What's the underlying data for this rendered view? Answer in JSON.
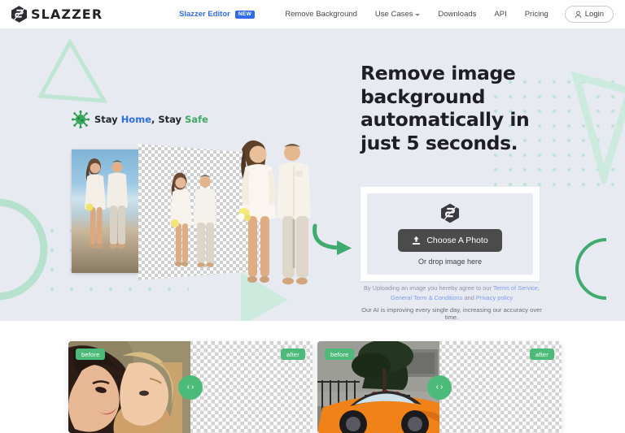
{
  "header": {
    "logo_text": "SLAZZER",
    "logo_icon": "slazzer-diamond-logo-icon",
    "nav": [
      {
        "label": "Slazzer Editor",
        "badge": "NEW",
        "accent": true
      },
      {
        "label": "Remove Background"
      },
      {
        "label": "Use Cases",
        "has_chevron": true
      },
      {
        "label": "Downloads"
      },
      {
        "label": "API"
      },
      {
        "label": "Pricing"
      }
    ],
    "login_label": "Login",
    "login_icon": "user-account-icon",
    "accent_color": "#2f6bf0"
  },
  "hero": {
    "headline": "Remove image background automatically in just 5 seconds.",
    "stay_safe": {
      "icon": "coronavirus-icon",
      "part1": "Stay ",
      "home": "Home",
      "part2": ", Stay ",
      "safe": "Safe"
    },
    "arrow_icon": "curved-arrow-right-icon",
    "upload": {
      "logo_icon": "slazzer-diamond-logo-icon",
      "button_label": "Choose A Photo",
      "button_icon": "upload-icon",
      "drop_text": "Or drop image here",
      "button_color": "#4b4b4b"
    },
    "legal": {
      "prefix": "By Uploading an image you hereby agree to our ",
      "link1": "Terms of Service",
      "sep1": ", ",
      "link2": "General Term & Conditions",
      "sep2": " and ",
      "link3": "Privacy policy"
    },
    "ai_note": "Our AI is improving every single day, increasing our accuracy over time.",
    "background_color": "#e8eaf2",
    "decor_green": "#b8e3cf"
  },
  "showcase": {
    "cards": [
      {
        "name": "mother-and-daughter",
        "before_label": "before",
        "after_label": "after"
      },
      {
        "name": "orange-sports-car",
        "before_label": "before",
        "after_label": "after"
      }
    ],
    "handle_icon": "compare-slider-handle-icon",
    "tag_color": "#4cbb7a"
  }
}
